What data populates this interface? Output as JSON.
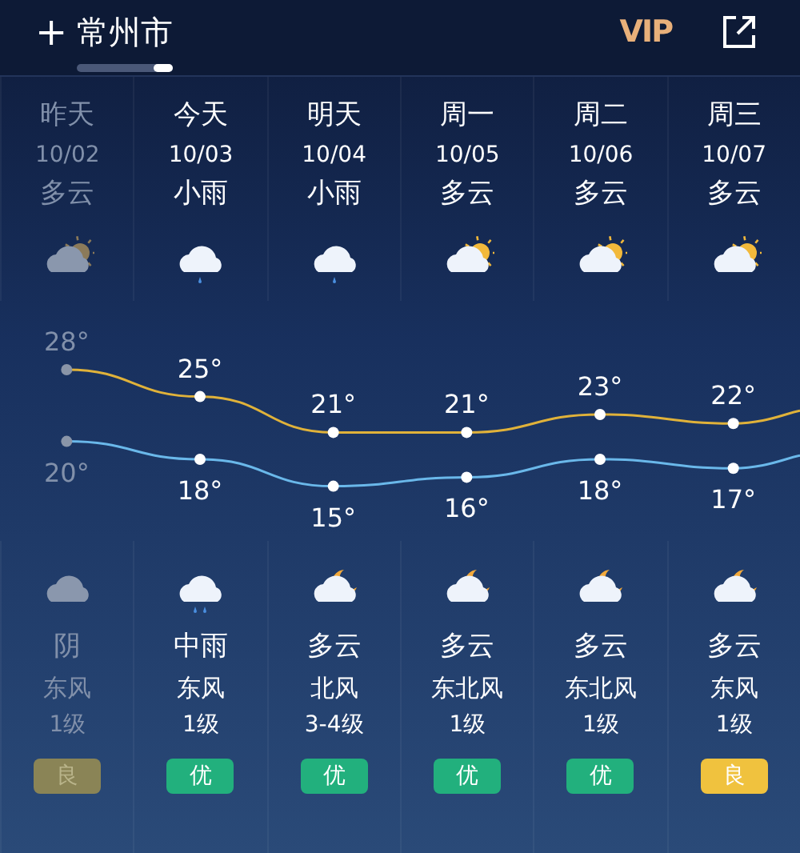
{
  "header": {
    "plus": "+",
    "city": "常州市",
    "vip": "VIP"
  },
  "days": [
    {
      "name": "昨天",
      "date": "10/02",
      "day_weather": "多云",
      "day_icon": {
        "kind": "sun-cloud"
      },
      "high": "28°",
      "low": "20°",
      "night_icon": {
        "kind": "overcast"
      },
      "night_weather": "阴",
      "wind": "东风",
      "wind_level": "1级",
      "aqi": {
        "text": "良",
        "color": "#8a8456"
      },
      "past": true
    },
    {
      "name": "今天",
      "date": "10/03",
      "day_weather": "小雨",
      "day_icon": {
        "kind": "light-rain"
      },
      "high": "25°",
      "low": "18°",
      "night_icon": {
        "kind": "rain"
      },
      "night_weather": "中雨",
      "wind": "东风",
      "wind_level": "1级",
      "aqi": {
        "text": "优",
        "color": "#22b07d"
      },
      "past": false
    },
    {
      "name": "明天",
      "date": "10/04",
      "day_weather": "小雨",
      "day_icon": {
        "kind": "light-rain"
      },
      "high": "21°",
      "low": "15°",
      "night_icon": {
        "kind": "moon-cloud"
      },
      "night_weather": "多云",
      "wind": "北风",
      "wind_level": "3-4级",
      "aqi": {
        "text": "优",
        "color": "#22b07d"
      },
      "past": false
    },
    {
      "name": "周一",
      "date": "10/05",
      "day_weather": "多云",
      "day_icon": {
        "kind": "sun-cloud"
      },
      "high": "21°",
      "low": "16°",
      "night_icon": {
        "kind": "moon-cloud"
      },
      "night_weather": "多云",
      "wind": "东北风",
      "wind_level": "1级",
      "aqi": {
        "text": "优",
        "color": "#22b07d"
      },
      "past": false
    },
    {
      "name": "周二",
      "date": "10/06",
      "day_weather": "多云",
      "day_icon": {
        "kind": "sun-cloud"
      },
      "high": "23°",
      "low": "18°",
      "night_icon": {
        "kind": "moon-cloud"
      },
      "night_weather": "多云",
      "wind": "东北风",
      "wind_level": "1级",
      "aqi": {
        "text": "优",
        "color": "#22b07d"
      },
      "past": false
    },
    {
      "name": "周三",
      "date": "10/07",
      "day_weather": "多云",
      "day_icon": {
        "kind": "sun-cloud"
      },
      "high": "22°",
      "low": "17°",
      "night_icon": {
        "kind": "moon-cloud"
      },
      "night_weather": "多云",
      "wind": "东风",
      "wind_level": "1级",
      "aqi": {
        "text": "良",
        "color": "#f0c23e"
      },
      "past": false
    }
  ]
}
